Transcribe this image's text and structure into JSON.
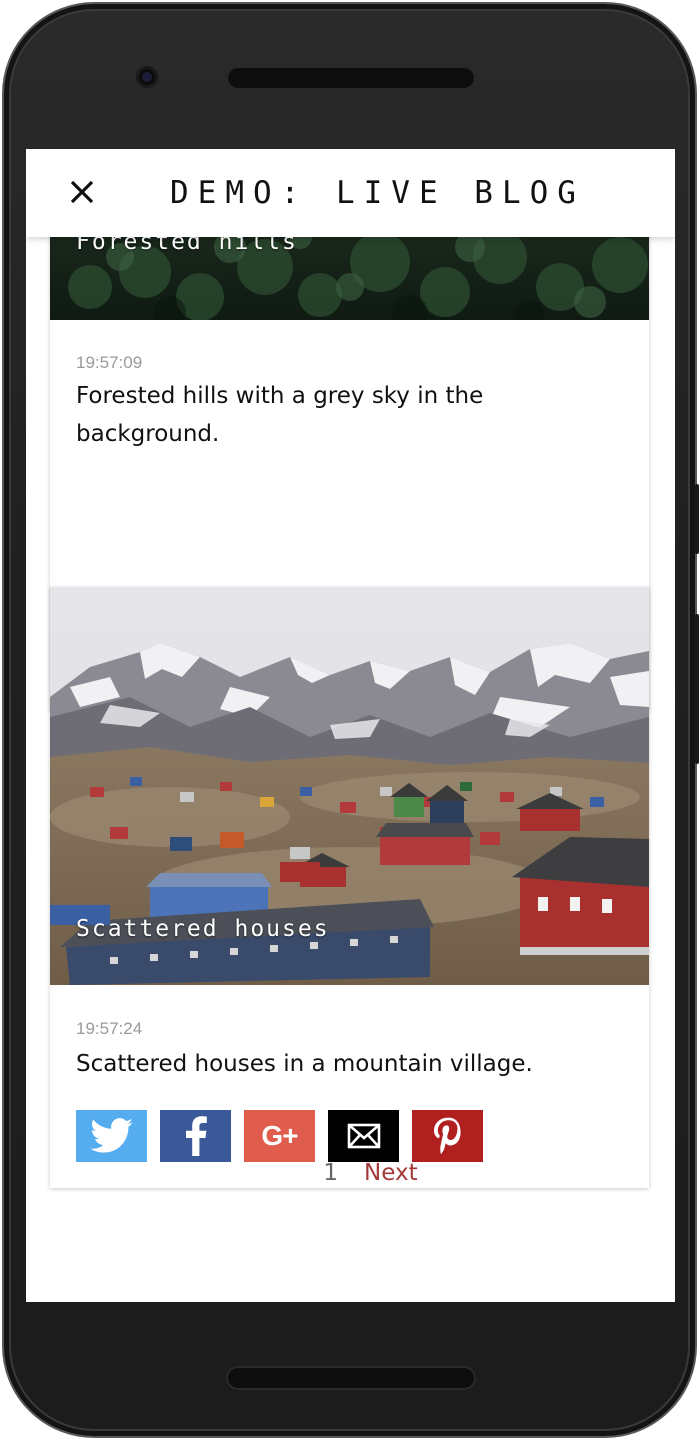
{
  "app": {
    "title": "DEMO: LIVE BLOG"
  },
  "posts": [
    {
      "image_caption": "Forested hills",
      "time": "19:57:09",
      "text": "Forested hills with a grey sky in the background."
    },
    {
      "image_caption": "Scattered houses",
      "time": "19:57:24",
      "text": "Scattered houses in a mountain village."
    }
  ],
  "share_buttons": [
    "twitter",
    "facebook",
    "google-plus",
    "email",
    "pinterest"
  ],
  "share_icons": {
    "google_plus_label": "G+"
  },
  "pagination": {
    "current": "1",
    "next": "Next"
  },
  "colors": {
    "twitter": "#55acee",
    "facebook": "#3b5998",
    "google_plus": "#dd4b39",
    "email": "#000000",
    "pinterest": "#b0201f",
    "next_link": "#a33a3a"
  }
}
